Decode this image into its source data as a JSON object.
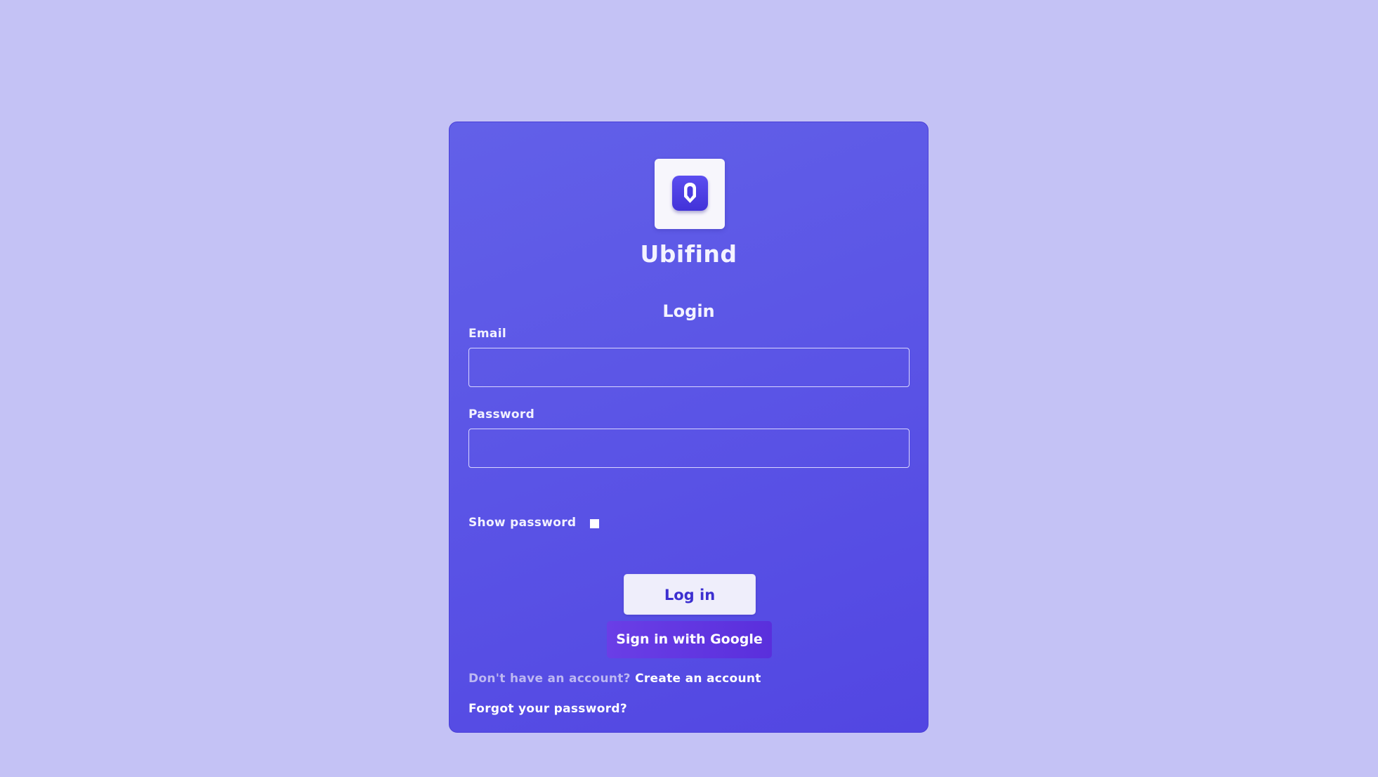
{
  "app": {
    "name": "Ubifind",
    "logo_icon": "location-pin-icon"
  },
  "form": {
    "title": "Login",
    "email_label": "Email",
    "email_value": "",
    "password_label": "Password",
    "password_value": "",
    "show_password_label": "Show password",
    "show_password_checked": false,
    "login_button": "Log in",
    "google_button": "Sign in with Google",
    "signup_prompt": "Don't have an account?",
    "signup_link": "Create an account",
    "forgot_link": "Forgot your password?"
  },
  "colors": {
    "background": "#c4c2f5",
    "card": "#5b55e6",
    "login_button_text": "#3c2fd0",
    "google_button": "#6a3ee6"
  }
}
